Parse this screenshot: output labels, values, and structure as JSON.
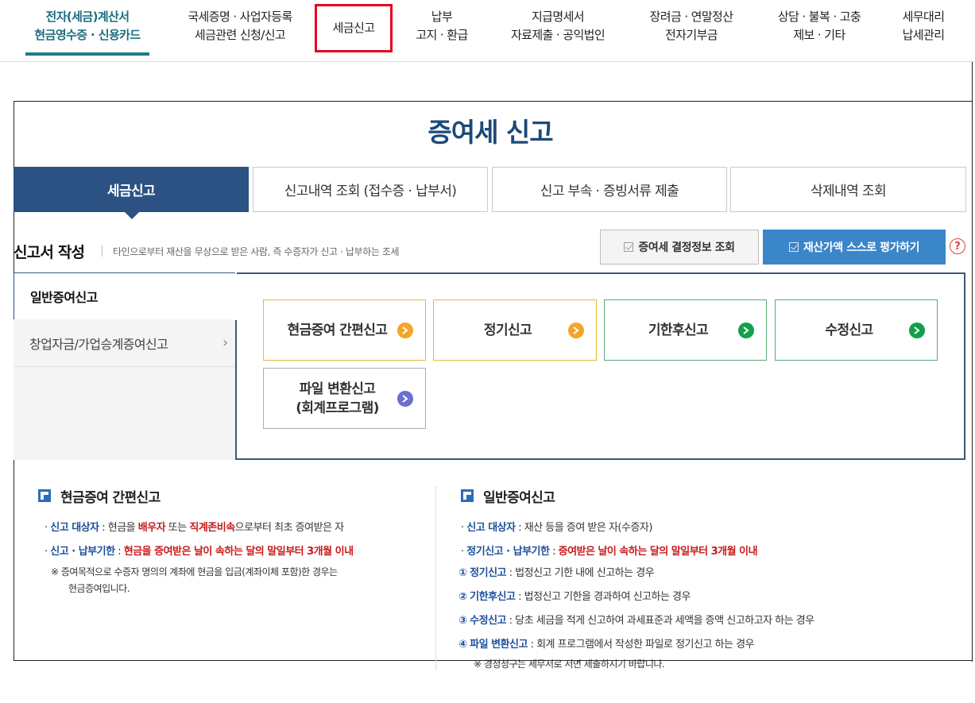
{
  "nav": [
    {
      "line1": "전자(세금)계산서",
      "line2": "현금영수증 · 신용카드"
    },
    {
      "line1": "국세증명 · 사업자등록",
      "line2": "세금관련 신청/신고"
    },
    {
      "line1": "세금신고",
      "line2": ""
    },
    {
      "line1": "납부",
      "line2": "고지 · 환급"
    },
    {
      "line1": "지급명세서",
      "line2": "자료제출 · 공익법인"
    },
    {
      "line1": "장려금 · 연말정산",
      "line2": "전자기부금"
    },
    {
      "line1": "상담 · 불복 · 고충",
      "line2": "제보 · 기타"
    },
    {
      "line1": "세무대리",
      "line2": "납세관리"
    }
  ],
  "page_title": "증여세 신고",
  "tabs": [
    "세금신고",
    "신고내역 조회 (접수증 · 납부서)",
    "신고 부속 · 증빙서류 제출",
    "삭제내역 조회"
  ],
  "section": {
    "title": "신고서 작성",
    "description": "타인으로부터 재산을 무상으로 받은 사람, 즉 수증자가 신고 · 납부하는 조세",
    "btn_decision": "증여세 결정정보 조회",
    "btn_evaluate": "재산가액 스스로 평가하기",
    "help": "?"
  },
  "side_menu": [
    "일반증여신고",
    "창업자금/가업승계증여신고"
  ],
  "side_chevron": "›",
  "cards": [
    "현금증여 간편신고",
    "정기신고",
    "기한후신고",
    "수정신고",
    "파일 변환신고",
    "(회계프로그램)"
  ],
  "colors": {
    "orange": "#f3a52a",
    "green": "#12a04a",
    "purple": "#6a6fd0"
  },
  "info_left": {
    "title": "현금증여 간편신고",
    "l1_label": "신고 대상자",
    "l1_a": " : 현금을 ",
    "l1_b": "배우자",
    "l1_c": " 또는 ",
    "l1_d": "직계존비속",
    "l1_e": "으로부터 최초 증여받은 자",
    "l2_label": "신고 · 납부기한",
    "l2_a": " : ",
    "l2_b": "현금을 증여받은 날이 속하는 달의 말일부터 3개월 이내",
    "note1": "※ 증여목적으로 수증자 명의의 계좌에 현금을 입금(계좌이체 포함)한 경우는",
    "note2": "현금증여입니다."
  },
  "info_right": {
    "title": "일반증여신고",
    "l1_label": "신고 대상자",
    "l1_text": " : 재산 등을 증여 받은 자(수증자)",
    "l2_label": "정기신고 · 납부기한",
    "l2_a": " : ",
    "l2_b": "증여받은 날이 속하는 달의 말일부터 3개월 이내",
    "items": [
      {
        "num": "①",
        "label": "정기신고",
        "text": " : 법정신고 기한 내에 신고하는 경우"
      },
      {
        "num": "②",
        "label": "기한후신고",
        "text": " : 법정신고 기한을 경과하여 신고하는 경우"
      },
      {
        "num": "③",
        "label": "수정신고",
        "text": " : 당초 세금을 적게 신고하여 과세표준과 세액을 증액 신고하고자 하는 경우"
      },
      {
        "num": "④",
        "label": "파일 변환신고",
        "text": " : 회계 프로그램에서 작성한 파일로 정기신고 하는 경우"
      }
    ],
    "note": "※ 경정청구는 세무서로 서면 제출하시기 바랍니다."
  }
}
